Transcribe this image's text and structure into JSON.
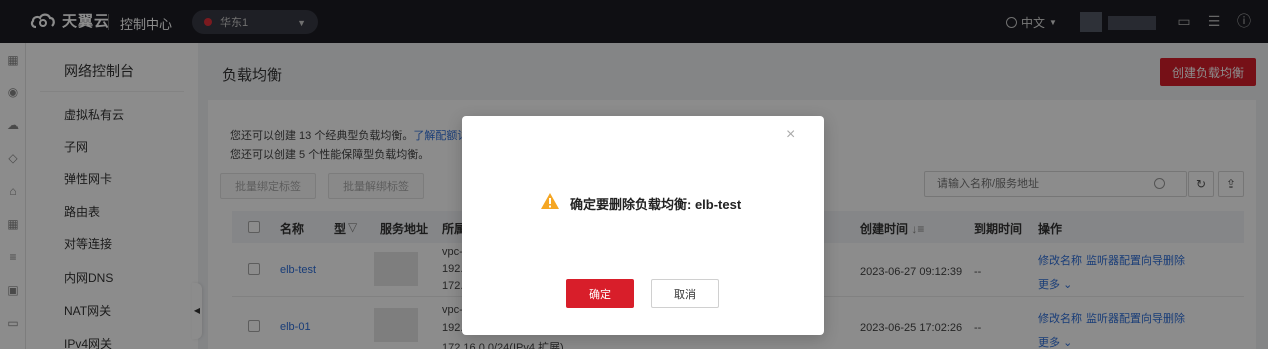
{
  "topbar": {
    "brand": "天翼云",
    "console": "控制中心",
    "region": "华东1",
    "lang": "中文"
  },
  "sidebar": {
    "title": "网络控制台",
    "items": [
      {
        "label": "虚拟私有云"
      },
      {
        "label": "子网"
      },
      {
        "label": "弹性网卡"
      },
      {
        "label": "路由表"
      },
      {
        "label": "对等连接"
      },
      {
        "label": "内网DNS"
      },
      {
        "label": "NAT网关"
      },
      {
        "label": "IPv4网关"
      }
    ]
  },
  "main": {
    "title": "负载均衡",
    "create_button": "创建负载均衡",
    "quota_line1": "您还可以创建 13 个经典型负载均衡。",
    "quota_link": "了解配额详情",
    "quota_line2": "您还可以创建 5 个性能保障型负载均衡。",
    "bulk_bind": "批量绑定标签",
    "bulk_unbind": "批量解绑标签",
    "search_placeholder": "请输入名称/服务地址",
    "columns": {
      "name": "名称",
      "type": "型",
      "service_address": "服务地址",
      "vpc": "所属",
      "created": "创建时间",
      "expire": "到期时间",
      "actions": "操作"
    },
    "rows": [
      {
        "name": "elb-test",
        "vpc_lines": [
          "vpc-",
          "192.",
          "172."
        ],
        "created": "2023-06-27 09:12:39",
        "expire": "--",
        "action_rename": "修改名称",
        "action_wizard": "监听器配置向导",
        "action_delete": "删除",
        "action_more": "更多"
      },
      {
        "name": "elb-01",
        "vpc_lines": [
          "vpc-",
          "192.",
          "172.16.0.0/24(IPv4 扩展)"
        ],
        "created": "2023-06-25 17:02:26",
        "expire": "--",
        "action_rename": "修改名称",
        "action_wizard": "监听器配置向导",
        "action_delete": "删除",
        "action_more": "更多"
      }
    ]
  },
  "modal": {
    "message": "确定要删除负载均衡: elb-test",
    "confirm": "确定",
    "cancel": "取消"
  }
}
